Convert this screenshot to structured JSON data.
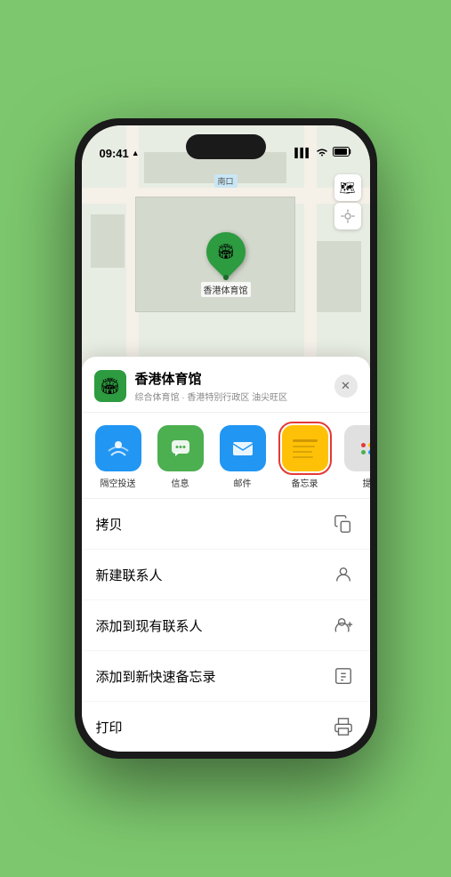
{
  "status_bar": {
    "time": "09:41",
    "location_arrow": "▶"
  },
  "map": {
    "label_nan": "南口",
    "controls": {
      "map_icon": "🗺",
      "location_icon": "⊕"
    }
  },
  "pin": {
    "label": "香港体育馆",
    "emoji": "🏟"
  },
  "venue": {
    "name": "香港体育馆",
    "description": "综合体育馆 · 香港特别行政区 油尖旺区",
    "emoji": "🏟"
  },
  "share_actions": [
    {
      "id": "airdrop",
      "label": "隔空投送",
      "type": "airdrop"
    },
    {
      "id": "messages",
      "label": "信息",
      "type": "messages"
    },
    {
      "id": "mail",
      "label": "邮件",
      "type": "mail"
    },
    {
      "id": "notes",
      "label": "备忘录",
      "type": "notes"
    },
    {
      "id": "more",
      "label": "提",
      "type": "more"
    }
  ],
  "action_items": [
    {
      "id": "copy",
      "label": "拷贝"
    },
    {
      "id": "new-contact",
      "label": "新建联系人"
    },
    {
      "id": "add-existing",
      "label": "添加到现有联系人"
    },
    {
      "id": "add-note",
      "label": "添加到新快速备忘录"
    },
    {
      "id": "print",
      "label": "打印"
    }
  ]
}
